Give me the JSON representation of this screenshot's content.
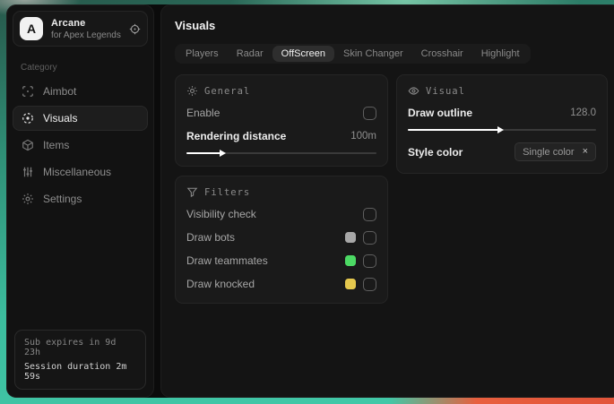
{
  "sidebar": {
    "app": {
      "initial": "A",
      "title": "Arcane",
      "subtitle": "for Apex Legends"
    },
    "category_label": "Category",
    "items": [
      {
        "label": "Aimbot",
        "icon": "aimbot-crosshair-icon",
        "selected": false
      },
      {
        "label": "Visuals",
        "icon": "visuals-scan-eye-icon",
        "selected": true
      },
      {
        "label": "Items",
        "icon": "items-cube-icon",
        "selected": false
      },
      {
        "label": "Miscellaneous",
        "icon": "sliders-icon",
        "selected": false
      },
      {
        "label": "Settings",
        "icon": "gear-icon",
        "selected": false
      }
    ],
    "header_icon": "target-icon",
    "footer": {
      "line1": "Sub expires in 9d 23h",
      "line2": "Session duration 2m 59s"
    }
  },
  "header": {
    "title": "Visuals"
  },
  "tabs": [
    {
      "label": "Players",
      "selected": false
    },
    {
      "label": "Radar",
      "selected": false
    },
    {
      "label": "OffScreen",
      "selected": true
    },
    {
      "label": "Skin Changer",
      "selected": false
    },
    {
      "label": "Crosshair",
      "selected": false
    },
    {
      "label": "Highlight",
      "selected": false
    }
  ],
  "panels": {
    "general": {
      "title": "General",
      "icon": "sun-icon",
      "enable_label": "Enable",
      "enable_checked": false,
      "rendering": {
        "label": "Rendering distance",
        "value": "100m",
        "percent": 20
      }
    },
    "visual": {
      "title": "Visual",
      "icon": "eye-icon",
      "outline": {
        "label": "Draw outline",
        "value": "128.0",
        "percent": 50
      },
      "style_color": {
        "label": "Style color",
        "value": "Single color",
        "clear_glyph": "×"
      }
    },
    "filters": {
      "title": "Filters",
      "icon": "funnel-icon",
      "rows": [
        {
          "label": "Visibility check",
          "swatch": null,
          "checked": false
        },
        {
          "label": "Draw bots",
          "swatch": "#a8a8a8",
          "checked": false
        },
        {
          "label": "Draw teammates",
          "swatch": "#4cd964",
          "checked": false
        },
        {
          "label": "Draw knocked",
          "swatch": "#e5c84e",
          "checked": false
        }
      ]
    }
  },
  "colors": {
    "background_teal": "#3cbd9e",
    "background_orange": "#e85f3e",
    "window_bg": "#0b0b0b",
    "panel_bg": "#1a1a1a",
    "selected_tab_bg": "#2e2e2e",
    "slider_fill": "#ffffff",
    "text_primary": "#ededed",
    "text_muted": "#8a8a8a"
  }
}
